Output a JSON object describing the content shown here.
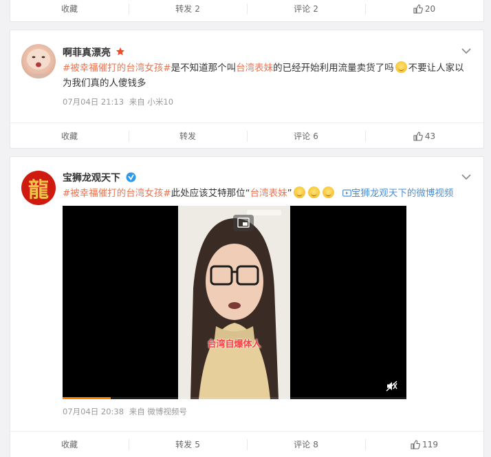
{
  "post0": {
    "actions": {
      "collect": "收藏",
      "repost": "转发",
      "repost_count": "2",
      "comment": "评论",
      "comment_count": "2",
      "like_count": "20"
    }
  },
  "post1": {
    "author": "啊菲真漂亮",
    "text": {
      "hashtag": "#被幸福催打的台湾女孩#",
      "part1": "是不知道那个叫",
      "highlight": "台湾表妹",
      "part2": "的已经开始利用流量卖货了吗",
      "part3": "不要让人家以为我们真的人傻钱多"
    },
    "meta": {
      "date": "07月04日 21:13",
      "source": "来自 小米10"
    },
    "actions": {
      "collect": "收藏",
      "repost": "转发",
      "comment": "评论",
      "comment_count": "6",
      "like_count": "43"
    }
  },
  "post2": {
    "author": "宝狮龙观天下",
    "avatar_char": "龍",
    "text": {
      "hashtag": "#被幸福催打的台湾女孩#",
      "part1": "此处应该艾特那位“",
      "highlight": "台湾表妹",
      "part2": "”",
      "video_link": "宝狮龙观天下的微博视频"
    },
    "video": {
      "caption": "台湾自爆体人",
      "progress": 0.14
    },
    "meta": {
      "date": "07月04日 20:38",
      "source": "来自 微博视频号"
    },
    "actions": {
      "collect": "收藏",
      "repost": "转发",
      "repost_count": "5",
      "comment": "评论",
      "comment_count": "8",
      "like_count": "119"
    }
  },
  "colors": {
    "tag": "#eb7350",
    "link": "#4a90d9",
    "progress": "#ff8200"
  },
  "icons": [
    "thumb-up-icon",
    "chevron-down-icon",
    "vip-star-icon",
    "verified-v-icon",
    "video-link-icon",
    "picture-in-picture-icon",
    "mute-icon",
    "emoji-smile-icon"
  ]
}
